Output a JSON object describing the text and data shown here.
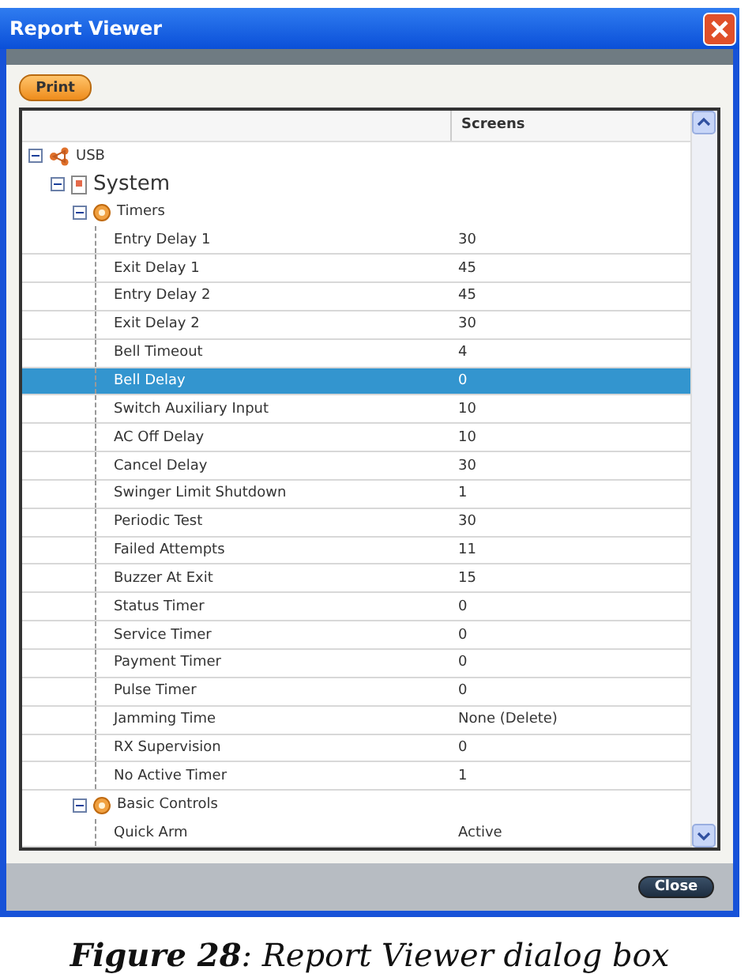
{
  "window": {
    "title": "Report Viewer"
  },
  "toolbar": {
    "print_button": "Print"
  },
  "tree": {
    "columns": [
      "Screens"
    ],
    "nodes": [
      {
        "kind": "device",
        "label": "USB",
        "expanded": true,
        "selected": false,
        "children": [
          {
            "kind": "page",
            "label": "System",
            "expanded": true,
            "selected": false,
            "children": [
              {
                "kind": "group",
                "label": "Timers",
                "expanded": true,
                "selected": false,
                "children": [
                  {
                    "kind": "setting",
                    "label": "Entry Delay 1",
                    "value": "30",
                    "selected": false
                  },
                  {
                    "kind": "setting",
                    "label": "Exit Delay 1",
                    "value": "45",
                    "selected": false
                  },
                  {
                    "kind": "setting",
                    "label": "Entry Delay 2",
                    "value": "45",
                    "selected": false
                  },
                  {
                    "kind": "setting",
                    "label": "Exit Delay 2",
                    "value": "30",
                    "selected": false
                  },
                  {
                    "kind": "setting",
                    "label": "Bell Timeout",
                    "value": "4",
                    "selected": false
                  },
                  {
                    "kind": "setting",
                    "label": "Bell Delay",
                    "value": "0",
                    "selected": true
                  },
                  {
                    "kind": "setting",
                    "label": "Switch Auxiliary Input",
                    "value": "10",
                    "selected": false
                  },
                  {
                    "kind": "setting",
                    "label": "AC Off Delay",
                    "value": "10",
                    "selected": false
                  },
                  {
                    "kind": "setting",
                    "label": "Cancel Delay",
                    "value": "30",
                    "selected": false
                  },
                  {
                    "kind": "setting",
                    "label": "Swinger Limit Shutdown",
                    "value": "1",
                    "selected": false
                  },
                  {
                    "kind": "setting",
                    "label": "Periodic Test",
                    "value": "30",
                    "selected": false
                  },
                  {
                    "kind": "setting",
                    "label": "Failed Attempts",
                    "value": "11",
                    "selected": false
                  },
                  {
                    "kind": "setting",
                    "label": "Buzzer At Exit",
                    "value": "15",
                    "selected": false
                  },
                  {
                    "kind": "setting",
                    "label": "Status Timer",
                    "value": "0",
                    "selected": false
                  },
                  {
                    "kind": "setting",
                    "label": "Service Timer",
                    "value": "0",
                    "selected": false
                  },
                  {
                    "kind": "setting",
                    "label": "Payment Timer",
                    "value": "0",
                    "selected": false
                  },
                  {
                    "kind": "setting",
                    "label": "Pulse Timer",
                    "value": "0",
                    "selected": false
                  },
                  {
                    "kind": "setting",
                    "label": "Jamming Time",
                    "value": "None (Delete)",
                    "selected": false
                  },
                  {
                    "kind": "setting",
                    "label": "RX Supervision",
                    "value": "0",
                    "selected": false
                  },
                  {
                    "kind": "setting",
                    "label": "No Active Timer",
                    "value": "1",
                    "selected": false
                  }
                ]
              },
              {
                "kind": "group",
                "label": "Basic Controls",
                "expanded": true,
                "selected": false,
                "children": [
                  {
                    "kind": "setting",
                    "label": "Quick Arm",
                    "value": "Active",
                    "selected": false
                  }
                ]
              }
            ]
          }
        ]
      }
    ]
  },
  "footer": {
    "close_button": "Close"
  },
  "caption": "**Figure 28**: Report Viewer dialog box"
}
